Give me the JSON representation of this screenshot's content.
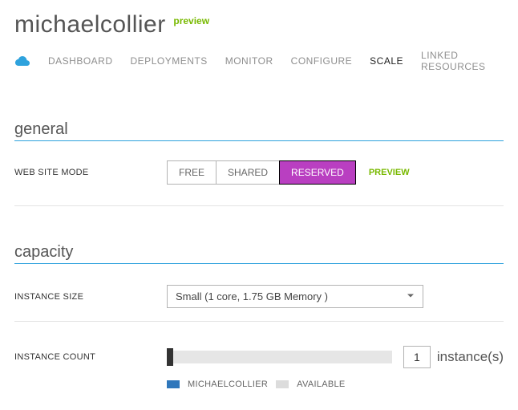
{
  "header": {
    "site_name": "michaelcollier",
    "preview_tag": "preview"
  },
  "tabs": {
    "items": [
      {
        "label": "DASHBOARD",
        "active": false
      },
      {
        "label": "DEPLOYMENTS",
        "active": false
      },
      {
        "label": "MONITOR",
        "active": false
      },
      {
        "label": "CONFIGURE",
        "active": false
      },
      {
        "label": "SCALE",
        "active": true
      },
      {
        "label": "LINKED RESOURCES",
        "active": false
      }
    ]
  },
  "sections": {
    "general": {
      "title": "general"
    },
    "capacity": {
      "title": "capacity"
    }
  },
  "mode": {
    "label": "WEB SITE MODE",
    "options": [
      "FREE",
      "SHARED",
      "RESERVED"
    ],
    "selected": "RESERVED",
    "preview": "PREVIEW"
  },
  "instance_size": {
    "label": "INSTANCE SIZE",
    "selected": "Small (1 core, 1.75 GB Memory )"
  },
  "instance_count": {
    "label": "INSTANCE COUNT",
    "value": "1",
    "suffix": "instance(s)"
  },
  "legend": {
    "used_label": "MICHAELCOLLIER",
    "available_label": "AVAILABLE"
  }
}
